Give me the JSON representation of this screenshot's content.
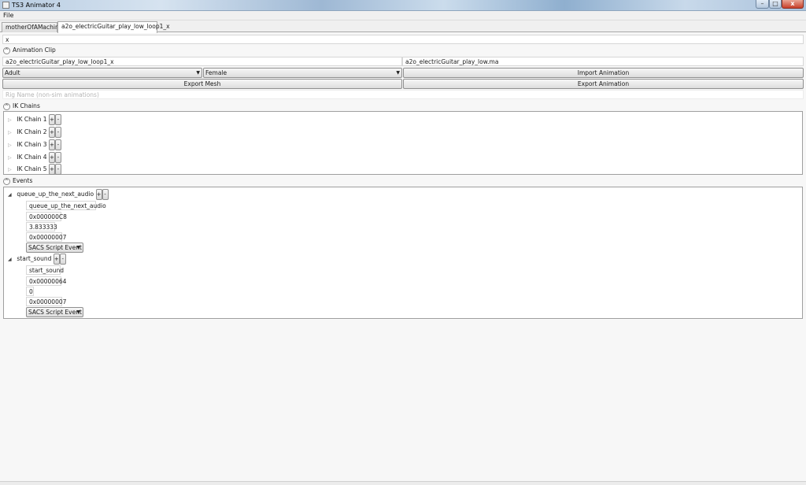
{
  "window": {
    "title": "TS3 Animator 4",
    "min": "–",
    "max": "□",
    "close": "x"
  },
  "menu": {
    "file": "File"
  },
  "tabs": [
    {
      "label": "motherOfAMachine",
      "selected": false
    },
    {
      "label": "a2o_electricGuitar_play_low_loop1_x",
      "selected": true
    }
  ],
  "top_input": {
    "value": "x"
  },
  "animation_clip": {
    "header": "Animation Clip",
    "clip_name": "a2o_electricGuitar_play_low_loop1_x",
    "source_file": "a2o_electricGuitar_play_low.ma",
    "age": "Adult",
    "gender": "Female",
    "import_label": "Import Animation",
    "export_mesh_label": "Export Mesh",
    "export_anim_label": "Export Animation",
    "rig_placeholder": "Rig Name (non-sim animations)"
  },
  "ik_chains": {
    "header": "IK Chains",
    "items": [
      {
        "label": "IK Chain 1"
      },
      {
        "label": "IK Chain 2"
      },
      {
        "label": "IK Chain 3"
      },
      {
        "label": "IK Chain 4"
      },
      {
        "label": "IK Chain 5"
      }
    ],
    "plus": "+",
    "minus": "-"
  },
  "events": {
    "header": "Events",
    "items": [
      {
        "title": "queue_up_the_next_audio",
        "name": "queue_up_the_next_audio",
        "id": "0x000000C8",
        "time": "3.833333",
        "flags": "0x00000007",
        "type": "SACS Script Event"
      },
      {
        "title": "start_sound",
        "name": "start_sound",
        "id": "0x00000064",
        "time": "0",
        "flags": "0x00000007",
        "type": "SACS Script Event"
      }
    ]
  },
  "icons": {
    "collapse": "^",
    "tree_collapsed": "▷",
    "tree_expanded": "◢",
    "dropdown": "▼"
  }
}
